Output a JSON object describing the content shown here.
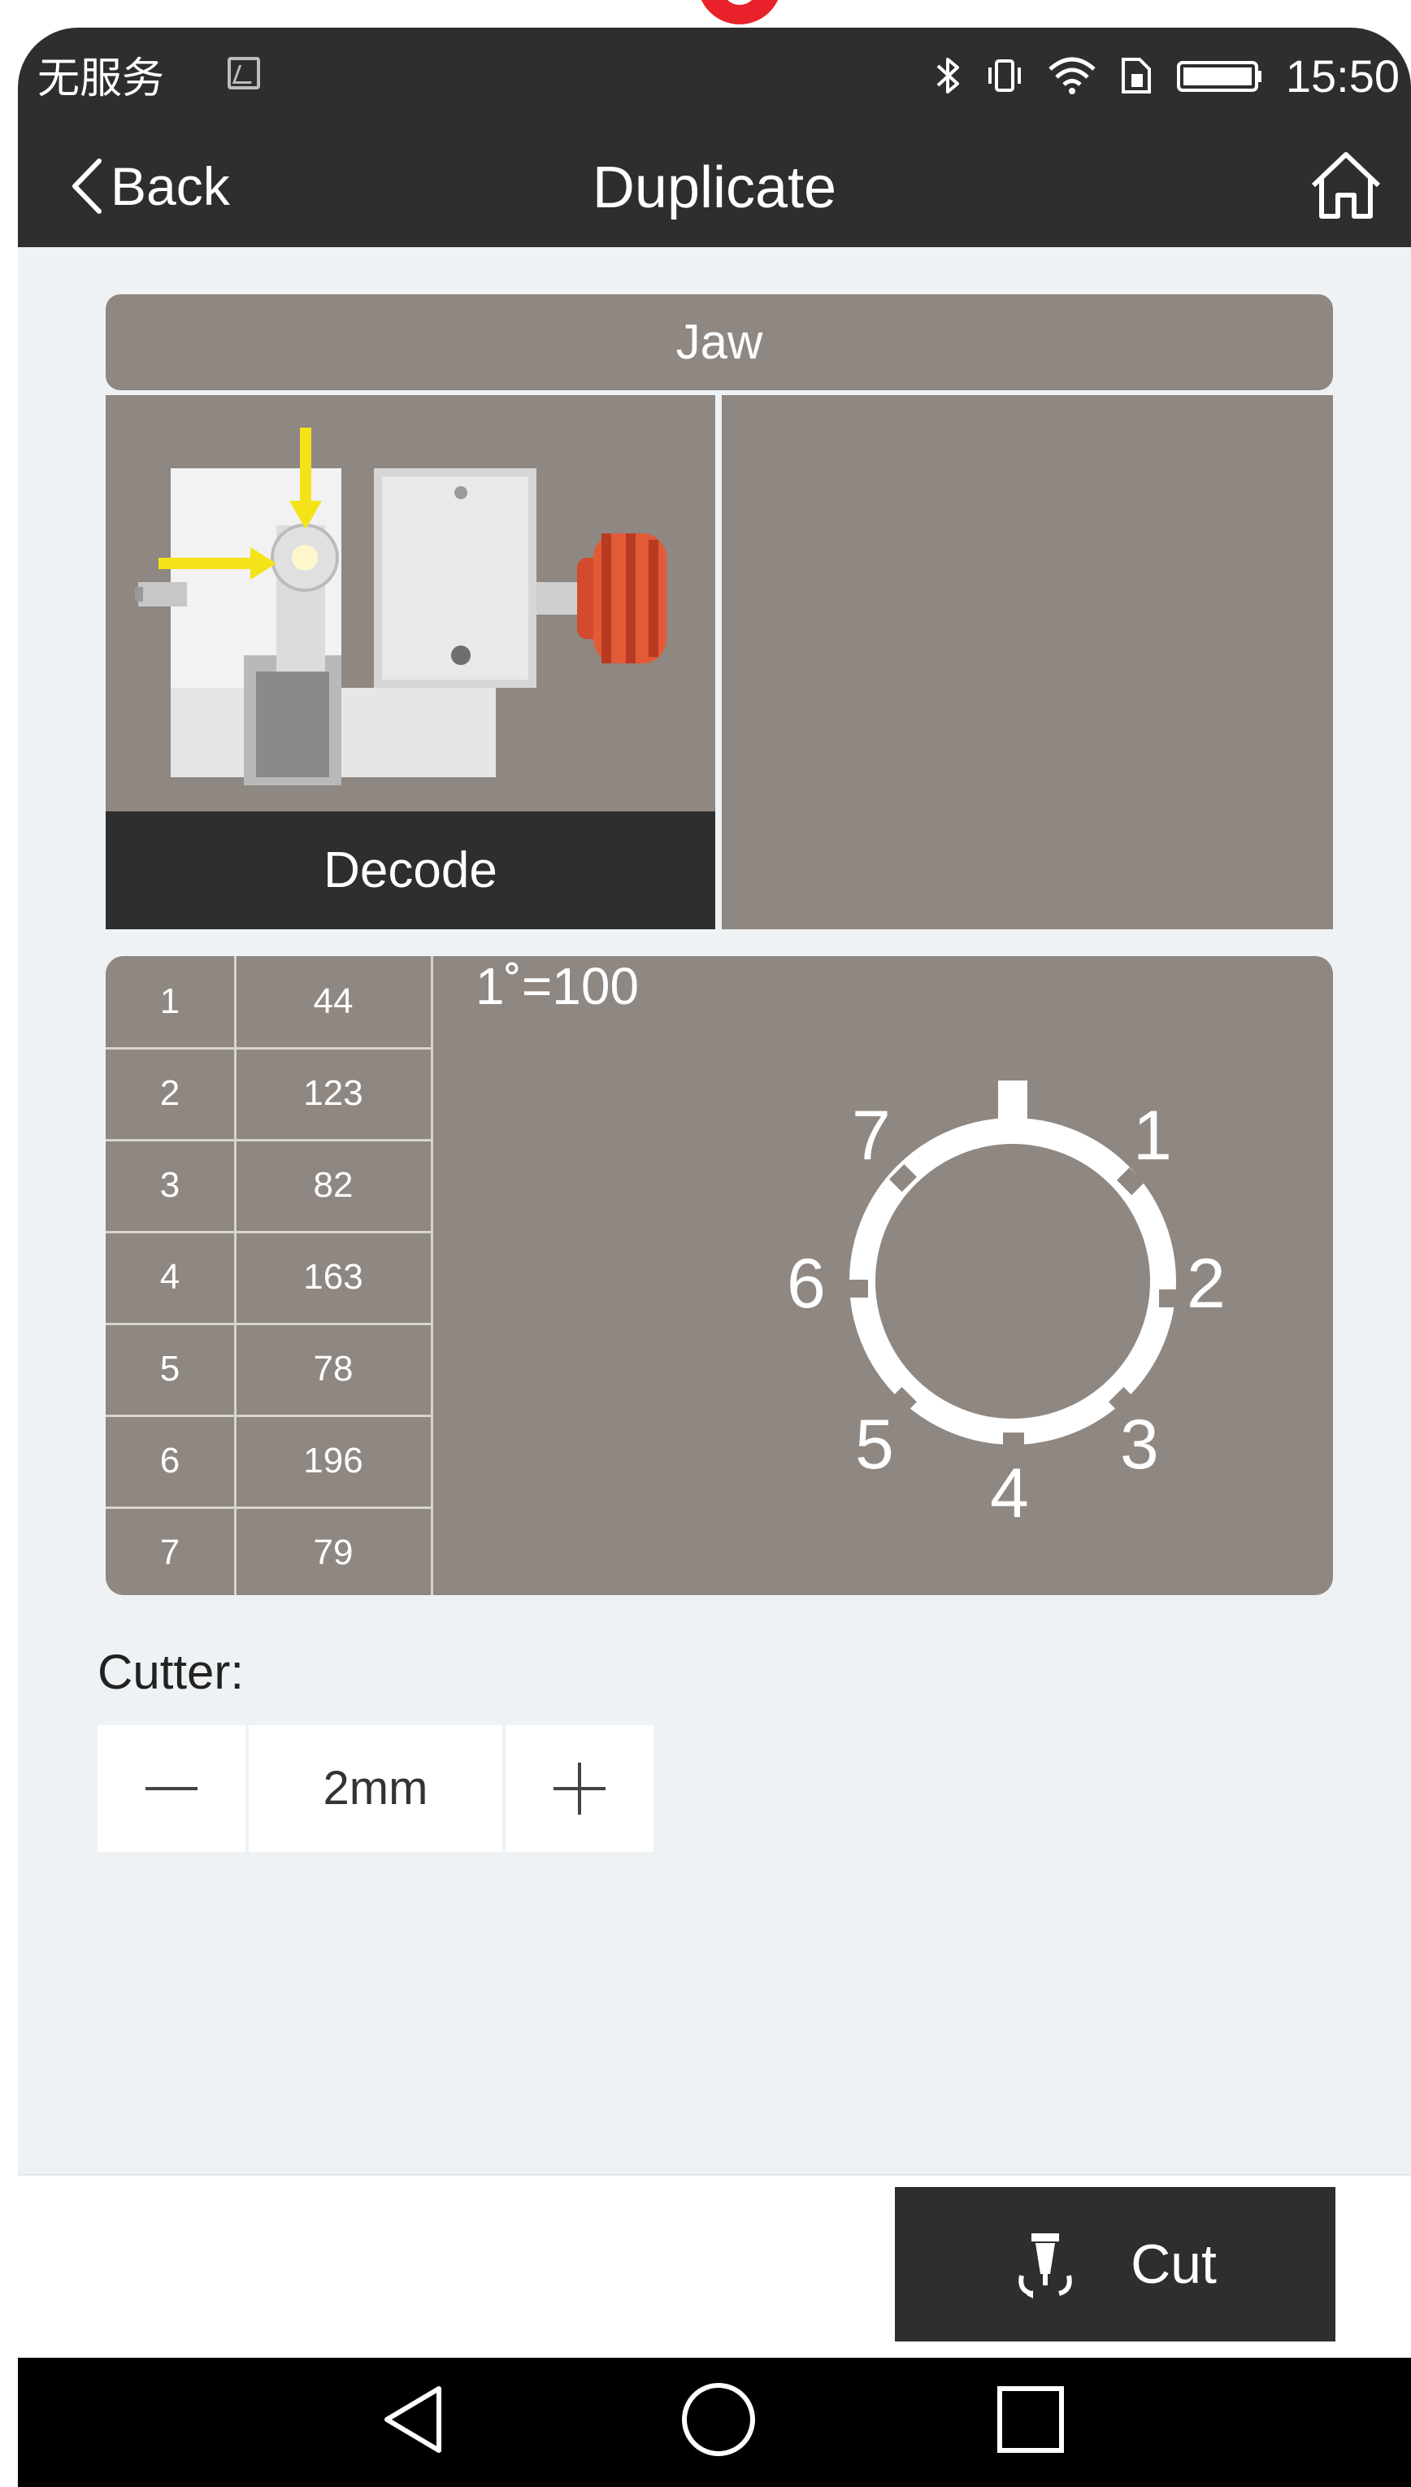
{
  "status_bar": {
    "carrier": "无服务",
    "time": "15:50",
    "icons": [
      "image-notification-icon",
      "bluetooth-icon",
      "vibrate-icon",
      "wifi-icon",
      "sim-icon",
      "battery-icon"
    ]
  },
  "header": {
    "back_label": "Back",
    "title": "Duplicate",
    "home_icon": "home-icon"
  },
  "jaw": {
    "title": "Jaw",
    "decode_label": "Decode"
  },
  "table": {
    "rows": [
      {
        "index": "1",
        "value": "44"
      },
      {
        "index": "2",
        "value": "123"
      },
      {
        "index": "3",
        "value": "82"
      },
      {
        "index": "4",
        "value": "163"
      },
      {
        "index": "5",
        "value": "78"
      },
      {
        "index": "6",
        "value": "196"
      },
      {
        "index": "7",
        "value": "79"
      }
    ]
  },
  "dial": {
    "scale_text": "1˚=100",
    "positions": [
      "1",
      "2",
      "3",
      "4",
      "5",
      "6",
      "7"
    ]
  },
  "cutter": {
    "label": "Cutter:",
    "value": "2mm",
    "minus_icon": "minus-icon",
    "plus_icon": "plus-icon"
  },
  "action": {
    "cut_label": "Cut",
    "cut_icon": "cutter-icon"
  },
  "navbar": {
    "icons": [
      "nav-back-icon",
      "nav-home-icon",
      "nav-recents-icon"
    ]
  },
  "colors": {
    "dark": "#2e2e2e",
    "panel": "#8f8781",
    "background": "#eef2f5",
    "accent_red": "#e8212a"
  }
}
